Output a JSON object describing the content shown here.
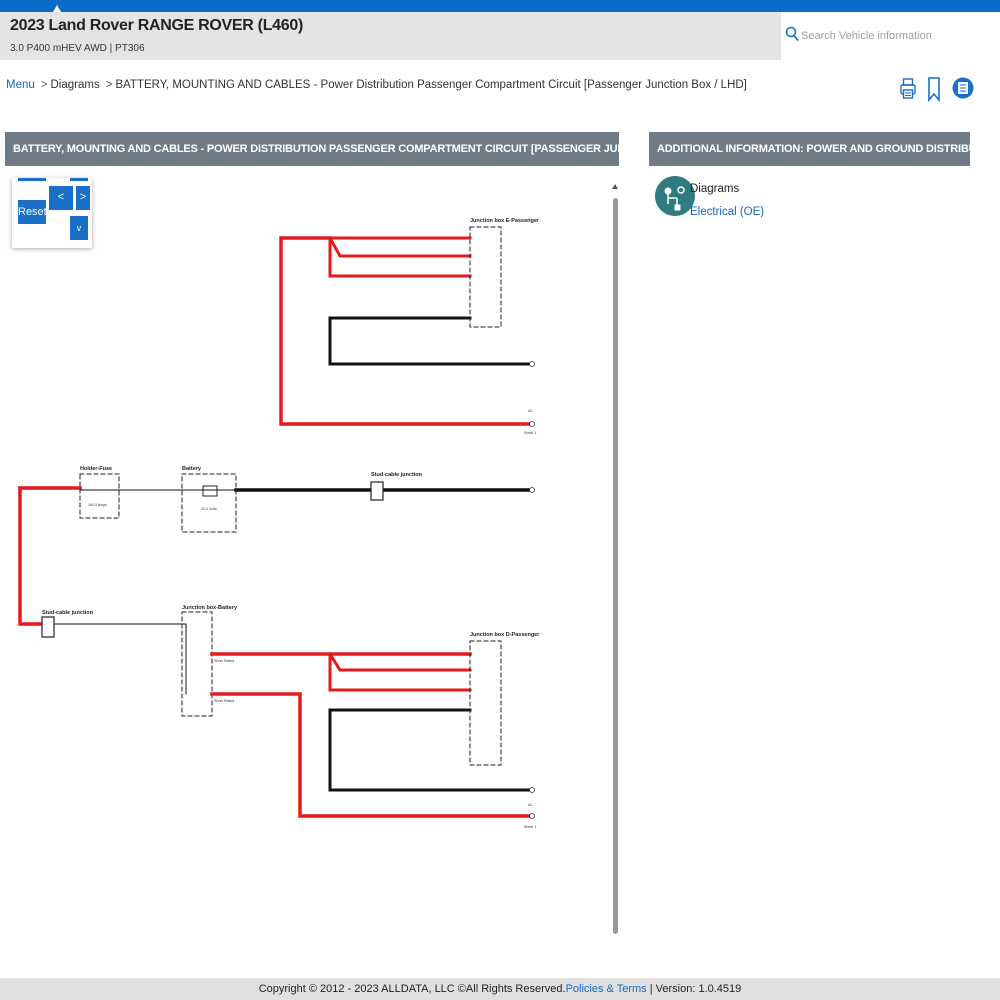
{
  "header": {
    "vehicle_title": "2023 Land Rover RANGE ROVER (L460)",
    "vehicle_subtitle": "3.0 P400 mHEV AWD | PT306",
    "search_placeholder": "Search Vehicle information"
  },
  "breadcrumb": {
    "menu": "Menu",
    "diagrams": "Diagrams",
    "current": "BATTERY, MOUNTING AND CABLES - Power Distribution Passenger Compartment Circuit [Passenger Junction Box / LHD]"
  },
  "toolbar": {
    "icons": [
      "print-icon",
      "bookmark-icon",
      "notes-icon"
    ]
  },
  "left_panel": {
    "title": "BATTERY, MOUNTING AND CABLES - POWER DISTRIBUTION PASSENGER COMPARTMENT CIRCUIT [PASSENGER JUNCTION BOX / LHD]"
  },
  "zoom": {
    "reset": "Reset",
    "left": "<",
    "right": ">",
    "down": "v"
  },
  "right_panel": {
    "title": "ADDITIONAL INFORMATION: POWER AND GROUND DISTRIBUTION",
    "item_title": "Diagrams",
    "item_link": "Electrical (OE)"
  },
  "diagram": {
    "colors": {
      "red": "#e31b1b",
      "black": "#111111"
    },
    "labels": {
      "jb_e_passenger": "Junction box E-Passenger",
      "holder_fuse": "Holder-Fuse",
      "battery": "Battery",
      "stud_cable_junction_1": "Stud-cable junction",
      "stud_cable_junction_2": "Stud-cable junction",
      "jb_battery": "Junction box-Battery",
      "jb_d_passenger": "Junction box D-Passenger",
      "sheet1": "Sheet 1",
      "a2": "A2",
      "volts": "12.0 Volts",
      "fuse_amps": "160.0 Amps",
      "silver_plated": "Silver Plated"
    }
  },
  "footer": {
    "copyright": "Copyright © 2012 - 2023 ALLDATA, LLC ©All Rights Reserved.",
    "policies": "Policies & Terms",
    "version": "| Version: 1.0.4519"
  }
}
